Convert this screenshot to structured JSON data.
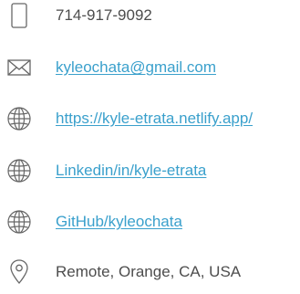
{
  "contacts": [
    {
      "icon": "phone-icon",
      "text": "714-917-9092"
    },
    {
      "icon": "mail-icon",
      "text": "kyleochata@gmail.com"
    },
    {
      "icon": "globe-icon",
      "text": "https://kyle-etrata.netlify.app/"
    },
    {
      "icon": "globe-icon",
      "text": "Linkedin/in/kyle-etrata"
    },
    {
      "icon": "globe-icon",
      "text": "GitHub/kyleochata"
    },
    {
      "icon": "location-pin-icon",
      "text": "Remote, Orange, CA, USA"
    }
  ],
  "colors": {
    "text": "#4d4d4d",
    "link": "#3aa0cc",
    "icon": "#666666"
  }
}
